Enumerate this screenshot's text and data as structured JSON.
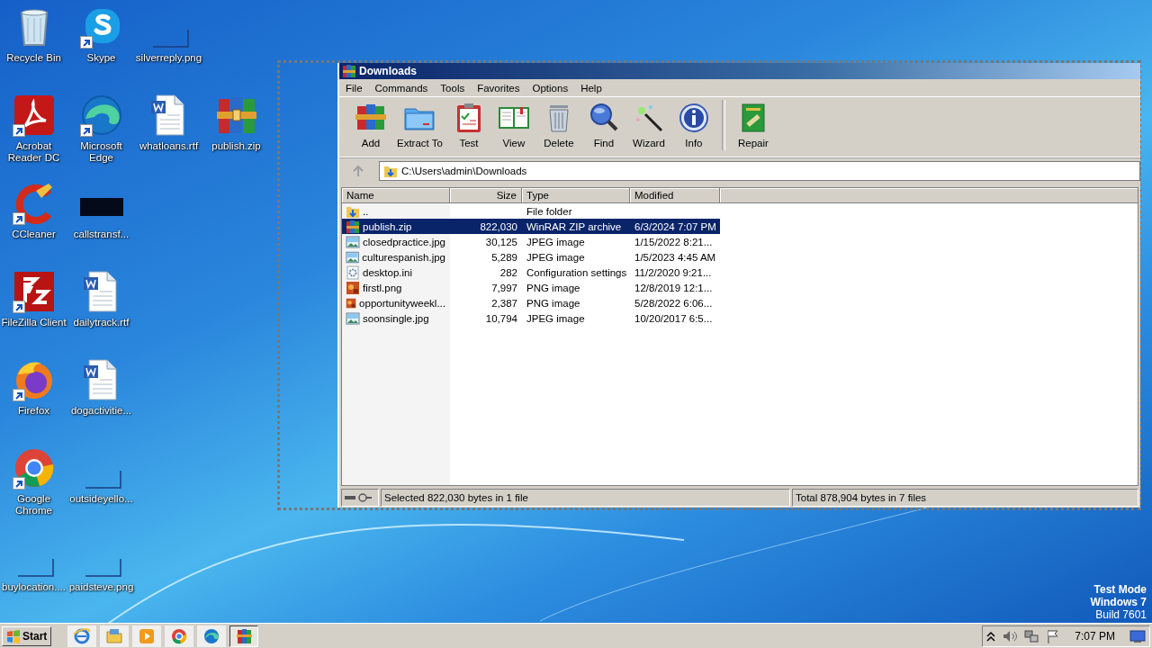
{
  "desktop": {
    "rows": [
      [
        {
          "label": "Recycle Bin",
          "kind": "recycle",
          "shortcut": false
        },
        {
          "label": "Skype",
          "kind": "skype",
          "shortcut": true
        },
        {
          "label": "silverreply.png",
          "kind": "blank",
          "shortcut": false
        }
      ],
      [
        {
          "label": "Acrobat Reader DC",
          "kind": "acrobat",
          "shortcut": true
        },
        {
          "label": "Microsoft Edge",
          "kind": "edge",
          "shortcut": true
        },
        {
          "label": "whatloans.rtf",
          "kind": "word",
          "shortcut": false
        },
        {
          "label": "publish.zip",
          "kind": "winrar",
          "shortcut": false
        }
      ],
      [
        {
          "label": "CCleaner",
          "kind": "ccleaner",
          "shortcut": true
        },
        {
          "label": "callstransf...",
          "kind": "dark",
          "shortcut": false
        }
      ],
      [
        {
          "label": "FileZilla Client",
          "kind": "filezilla",
          "shortcut": true
        },
        {
          "label": "dailytrack.rtf",
          "kind": "word",
          "shortcut": false
        }
      ],
      [
        {
          "label": "Firefox",
          "kind": "firefox",
          "shortcut": true
        },
        {
          "label": "dogactivitie...",
          "kind": "word",
          "shortcut": false
        }
      ],
      [
        {
          "label": "Google Chrome",
          "kind": "chrome",
          "shortcut": true
        },
        {
          "label": "outsideyello...",
          "kind": "blank",
          "shortcut": false
        }
      ],
      [
        {
          "label": "buylocation....",
          "kind": "blank",
          "shortcut": false
        },
        {
          "label": "paidsteve.png",
          "kind": "blank",
          "shortcut": false
        }
      ]
    ]
  },
  "window": {
    "title": "Downloads",
    "menu": [
      "File",
      "Commands",
      "Tools",
      "Favorites",
      "Options",
      "Help"
    ],
    "toolbar": [
      {
        "label": "Add",
        "kind": "add"
      },
      {
        "label": "Extract To",
        "kind": "extract"
      },
      {
        "label": "Test",
        "kind": "test"
      },
      {
        "label": "View",
        "kind": "view"
      },
      {
        "label": "Delete",
        "kind": "delete"
      },
      {
        "label": "Find",
        "kind": "find"
      },
      {
        "label": "Wizard",
        "kind": "wizard"
      },
      {
        "label": "Info",
        "kind": "info"
      },
      {
        "label": "Repair",
        "kind": "repair",
        "separated": true
      }
    ],
    "address": "C:\\Users\\admin\\Downloads",
    "table": {
      "columns": [
        "Name",
        "Size",
        "Type",
        "Modified"
      ],
      "rows": [
        {
          "name": "..",
          "size": "",
          "type": "File folder",
          "modified": "",
          "kind": "up",
          "selected": false
        },
        {
          "name": "publish.zip",
          "size": "822,030",
          "type": "WinRAR ZIP archive",
          "modified": "6/3/2024 7:07 PM",
          "kind": "zip",
          "selected": true
        },
        {
          "name": "closedpractice.jpg",
          "size": "30,125",
          "type": "JPEG image",
          "modified": "1/15/2022 8:21...",
          "kind": "jpeg",
          "selected": false
        },
        {
          "name": "culturespanish.jpg",
          "size": "5,289",
          "type": "JPEG image",
          "modified": "1/5/2023 4:45 AM",
          "kind": "jpeg",
          "selected": false
        },
        {
          "name": "desktop.ini",
          "size": "282",
          "type": "Configuration settings",
          "modified": "11/2/2020 9:21...",
          "kind": "ini",
          "selected": false
        },
        {
          "name": "firstl.png",
          "size": "7,997",
          "type": "PNG image",
          "modified": "12/8/2019 12:1...",
          "kind": "png",
          "selected": false
        },
        {
          "name": "opportunityweekl...",
          "size": "2,387",
          "type": "PNG image",
          "modified": "5/28/2022 6:06...",
          "kind": "png",
          "selected": false
        },
        {
          "name": "soonsingle.jpg",
          "size": "10,794",
          "type": "JPEG image",
          "modified": "10/20/2017 6:5...",
          "kind": "jpeg",
          "selected": false
        }
      ]
    },
    "status_bar": {
      "selected": "Selected 822,030 bytes in 1 file",
      "total": "Total 878,904 bytes in 7 files"
    }
  },
  "watermark_text": [
    "Test Mode",
    "Windows 7",
    "Build 7601"
  ],
  "taskbar": {
    "start": "Start",
    "items": [
      {
        "kind": "ie",
        "selected": false
      },
      {
        "kind": "explorer",
        "selected": false
      },
      {
        "kind": "media",
        "selected": false
      },
      {
        "kind": "chrome",
        "selected": false
      },
      {
        "kind": "edge",
        "selected": false
      },
      {
        "kind": "winrar",
        "selected": true
      }
    ],
    "clock": "7:07 PM"
  }
}
